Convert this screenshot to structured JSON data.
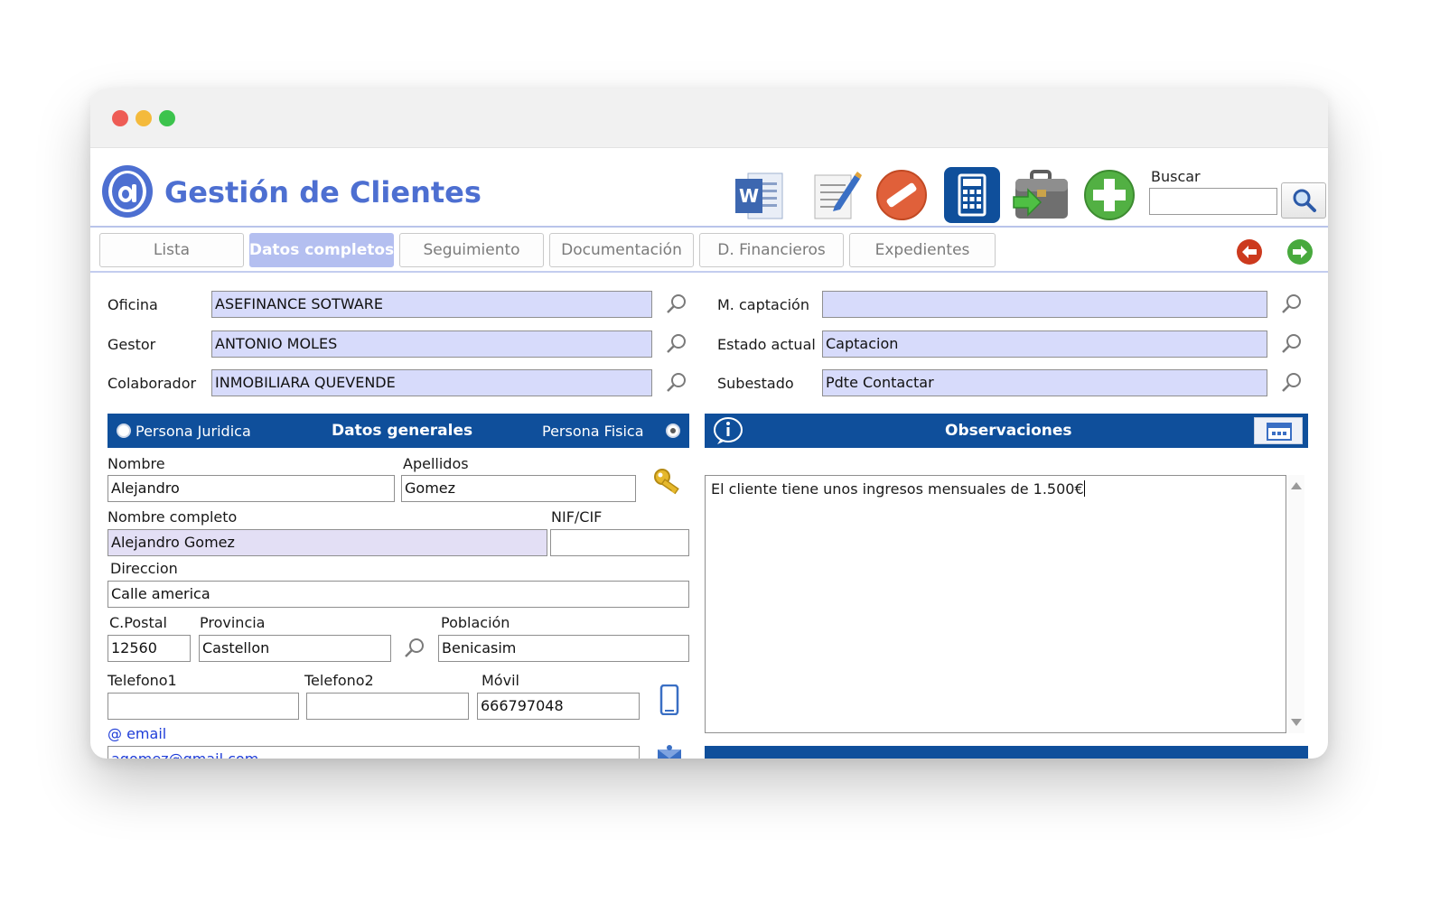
{
  "app": {
    "title": "Gestión de Clientes"
  },
  "toolbar": {
    "icons": [
      "word-icon",
      "edit-note-icon",
      "cancel-icon",
      "calculator-icon",
      "briefcase-export-icon",
      "add-icon"
    ],
    "search_label": "Buscar",
    "search_value": ""
  },
  "tabs": [
    {
      "label": "Lista",
      "active": false
    },
    {
      "label": "Datos completos",
      "active": true
    },
    {
      "label": "Seguimiento",
      "active": false
    },
    {
      "label": "Documentación",
      "active": false
    },
    {
      "label": "D. Financieros",
      "active": false
    },
    {
      "label": "Expedientes",
      "active": false
    }
  ],
  "top_fields": {
    "oficina": {
      "label": "Oficina",
      "value": "ASEFINANCE SOTWARE"
    },
    "gestor": {
      "label": "Gestor",
      "value": "ANTONIO MOLES"
    },
    "colaborador": {
      "label": "Colaborador",
      "value": "INMOBILIARA QUEVENDE"
    },
    "captacion": {
      "label": "M. captación",
      "value": ""
    },
    "estado": {
      "label": "Estado actual",
      "value": "Captacion"
    },
    "subestado": {
      "label": "Subestado",
      "value": "Pdte Contactar"
    }
  },
  "datos_generales": {
    "title": "Datos generales",
    "persona_juridica": "Persona Juridica",
    "persona_fisica": "Persona Fisica",
    "selected": "Persona Fisica",
    "nombre": {
      "label": "Nombre",
      "value": "Alejandro"
    },
    "apellidos": {
      "label": "Apellidos",
      "value": "Gomez"
    },
    "nombre_completo": {
      "label": "Nombre completo",
      "value": "Alejandro Gomez"
    },
    "nif": {
      "label": "NIF/CIF",
      "value": ""
    },
    "direccion": {
      "label": "Direccion",
      "value": "Calle america"
    },
    "cpostal": {
      "label": "C.Postal",
      "value": "12560"
    },
    "provincia": {
      "label": "Provincia",
      "value": "Castellon"
    },
    "poblacion": {
      "label": "Población",
      "value": "Benicasim"
    },
    "telefono1": {
      "label": "Telefono1",
      "value": ""
    },
    "telefono2": {
      "label": "Telefono2",
      "value": ""
    },
    "movil": {
      "label": "Móvil",
      "value": "666797048"
    },
    "email": {
      "label": "@ email",
      "value": "agomez@gmail.com"
    }
  },
  "observaciones": {
    "title": "Observaciones",
    "text": "El cliente tiene unos ingresos mensuales de 1.500€"
  },
  "colors": {
    "accent": "#4d6fd1",
    "section_bar": "#0f4f9b",
    "tab_active": "#b4bff0",
    "field_lavender": "#d7dbfb"
  }
}
